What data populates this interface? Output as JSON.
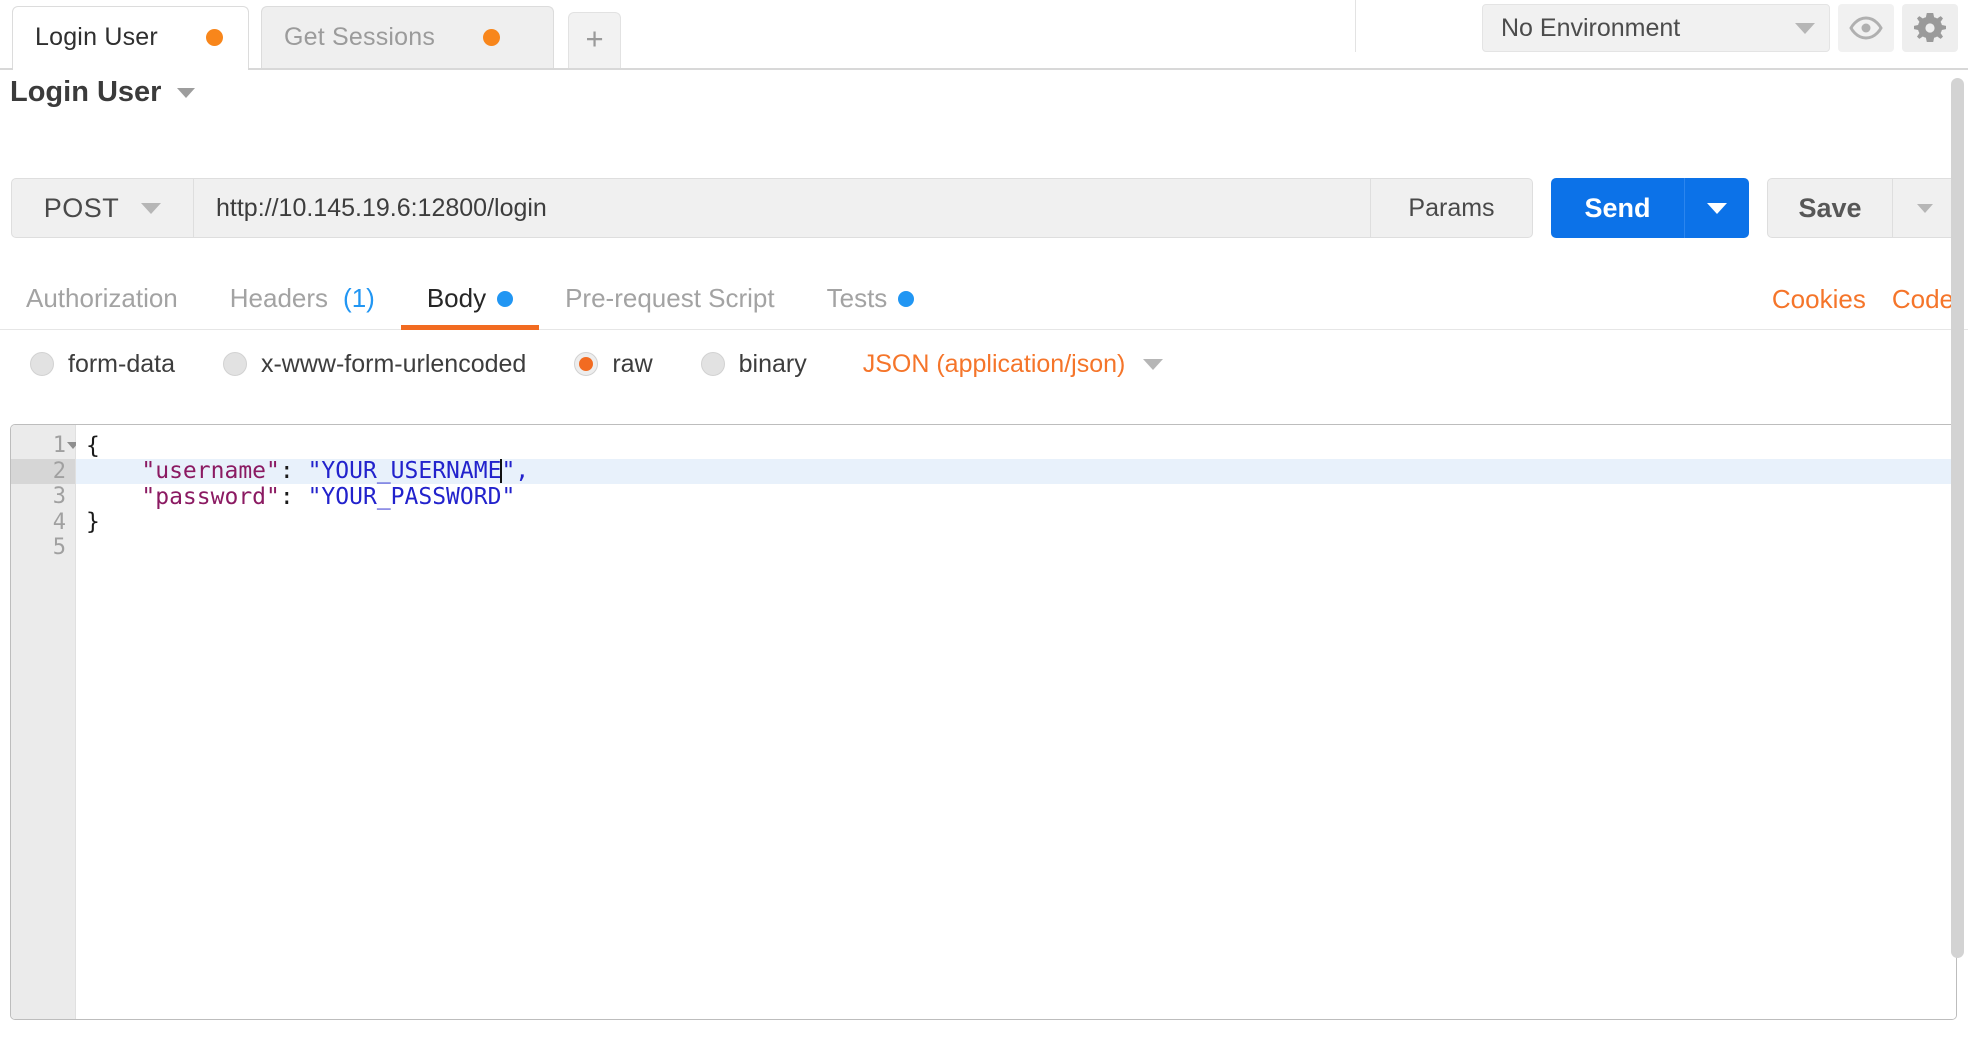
{
  "tabs": {
    "items": [
      {
        "label": "Login User",
        "active": true,
        "unsaved": true
      },
      {
        "label": "Get Sessions",
        "active": false,
        "unsaved": true
      }
    ],
    "add_label": "+"
  },
  "environment": {
    "selected": "No Environment",
    "eye_icon": "eye-icon",
    "gear_icon": "gear-icon"
  },
  "request": {
    "name": "Login User",
    "method": "POST",
    "url": "http://10.145.19.6:12800/login",
    "params_label": "Params",
    "send_label": "Send",
    "save_label": "Save"
  },
  "section_tabs": {
    "items": [
      {
        "label": "Authorization",
        "active": false
      },
      {
        "label": "Headers",
        "count": "(1)",
        "active": false
      },
      {
        "label": "Body",
        "active": true,
        "dot": true
      },
      {
        "label": "Pre-request Script",
        "active": false
      },
      {
        "label": "Tests",
        "active": false,
        "dot": true
      }
    ],
    "cookies_label": "Cookies",
    "code_label": "Code"
  },
  "body_type": {
    "options": [
      {
        "label": "form-data",
        "selected": false
      },
      {
        "label": "x-www-form-urlencoded",
        "selected": false
      },
      {
        "label": "raw",
        "selected": true
      },
      {
        "label": "binary",
        "selected": false
      }
    ],
    "content_type": "JSON (application/json)"
  },
  "editor": {
    "line_numbers": [
      "1",
      "2",
      "3",
      "4",
      "5"
    ],
    "active_line": 2,
    "lines": [
      {
        "n": "1",
        "open_brace": "{"
      },
      {
        "n": "2",
        "key": "\"username\"",
        "colon": ": ",
        "value": "\"YOUR_USERNAME",
        "tail": "\","
      },
      {
        "n": "3",
        "key": "\"password\"",
        "colon": ": ",
        "value": "\"YOUR_PASSWORD\""
      },
      {
        "n": "4",
        "close_brace": "}"
      },
      {
        "n": "5"
      }
    ]
  },
  "colors": {
    "accent_orange": "#f26b21",
    "send_blue": "#0c72e8",
    "link_orange": "#f5752a",
    "dot_blue": "#2196f3",
    "json_key": "#8b1a62",
    "json_string": "#2222cc"
  }
}
